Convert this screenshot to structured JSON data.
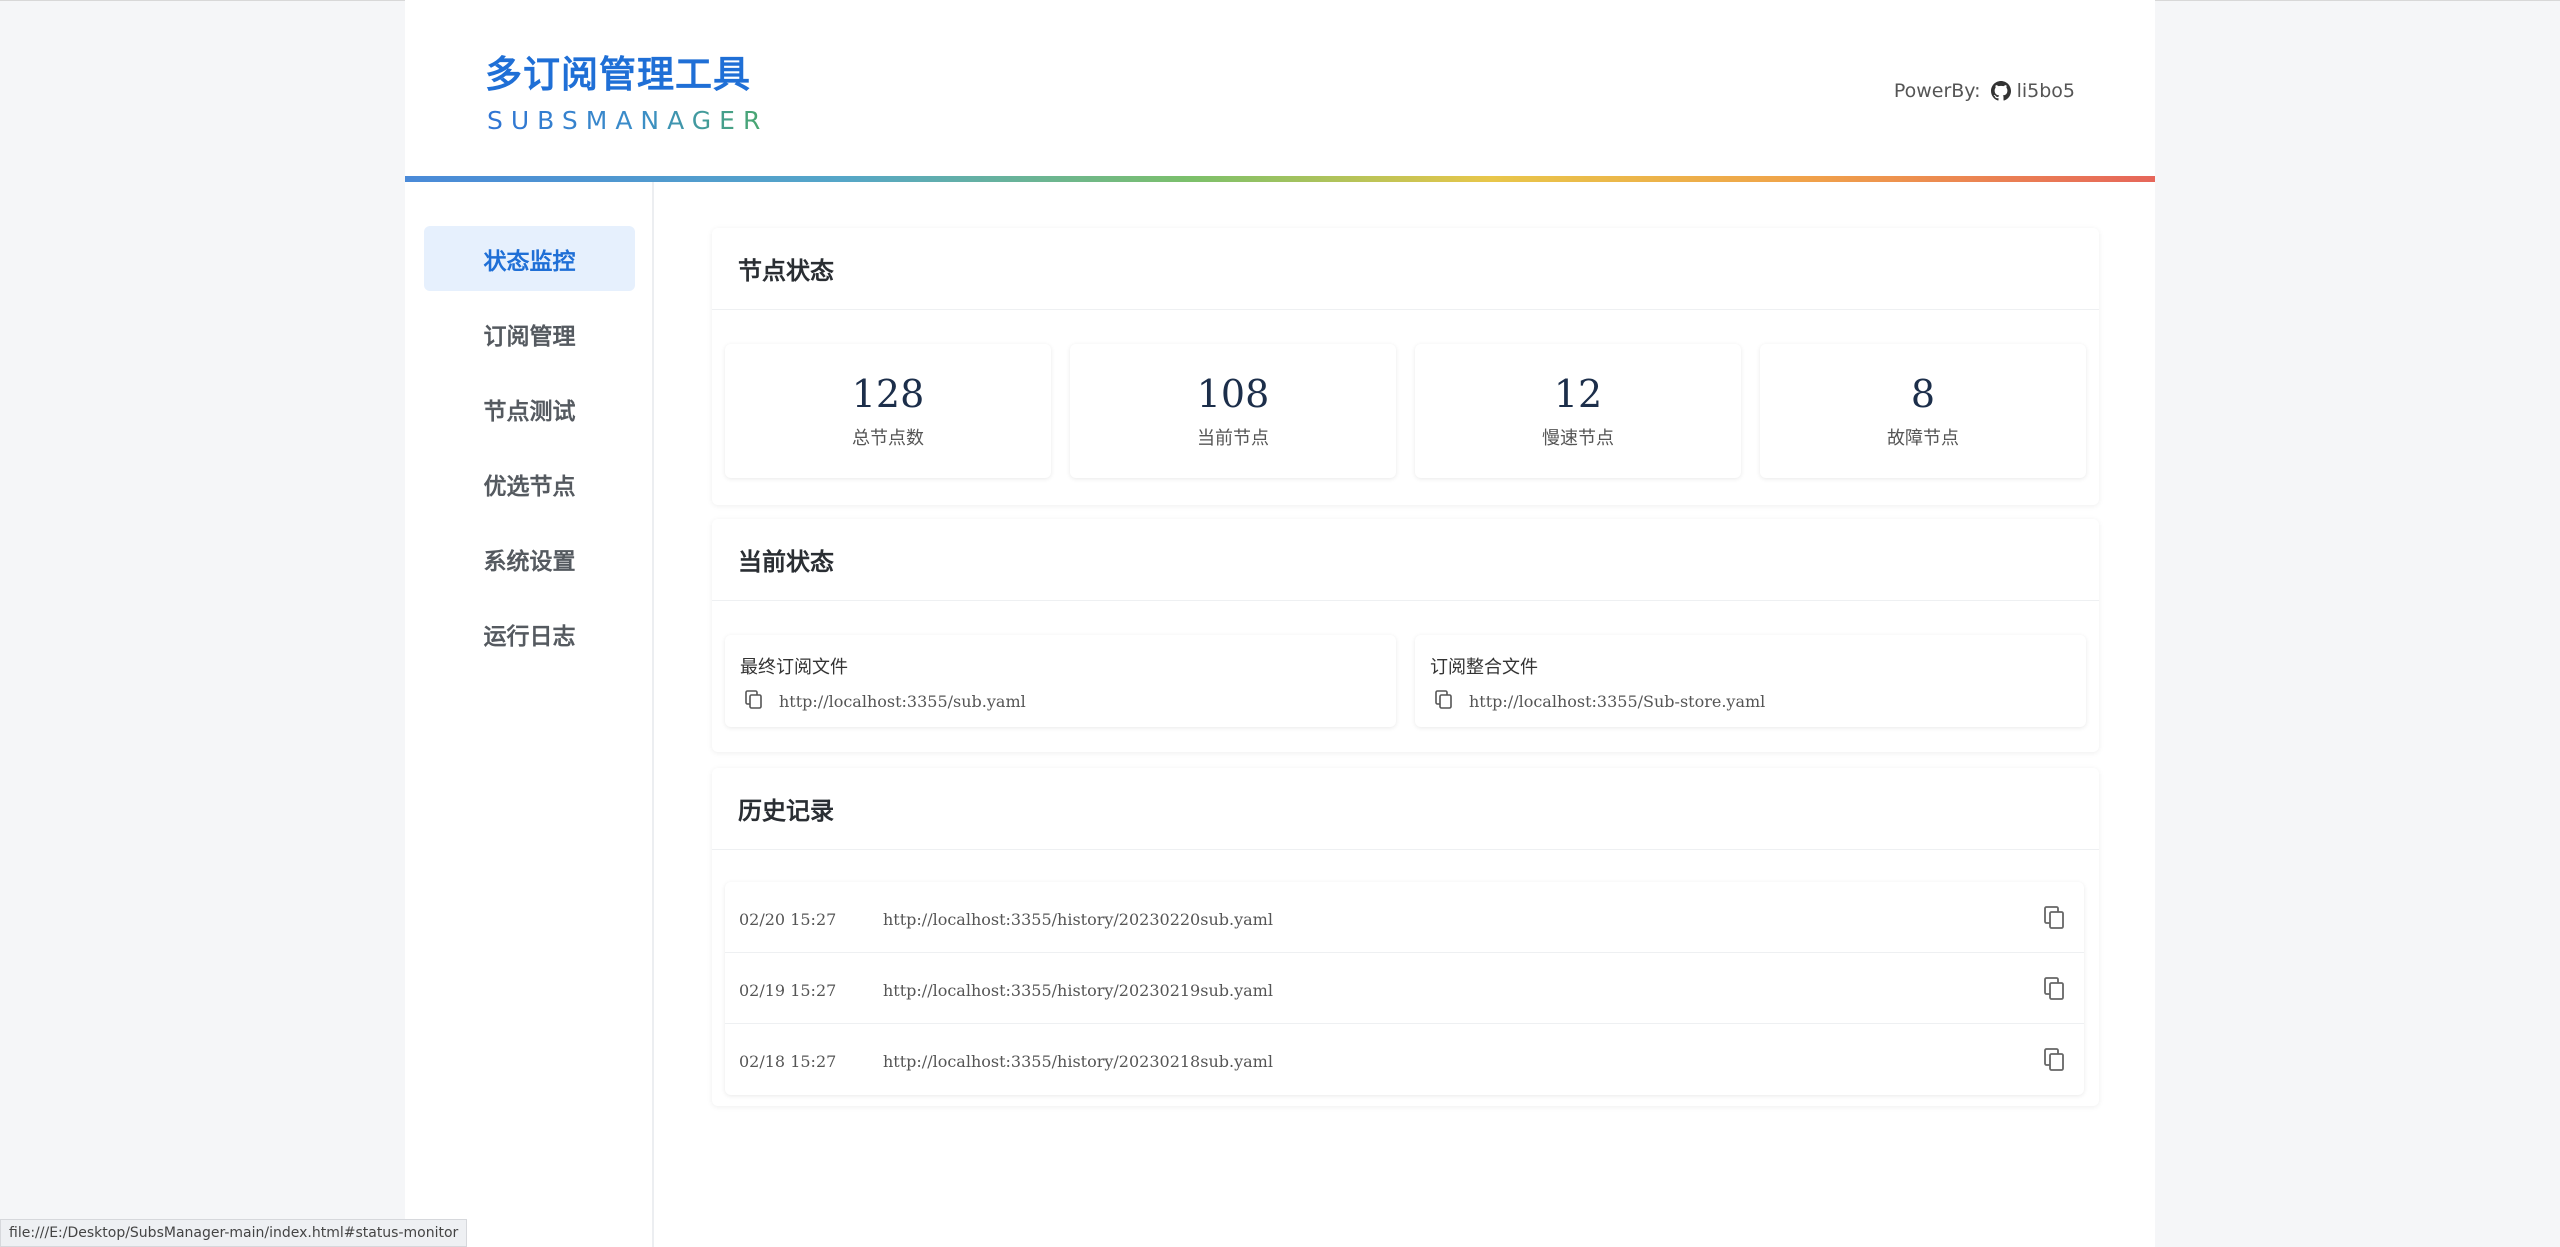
{
  "header": {
    "title": "多订阅管理工具",
    "subtitle": "SUBSMANAGER",
    "powerby_label": "PowerBy:",
    "powerby_user": "li5bo5",
    "github_icon": "github-icon"
  },
  "sidebar": {
    "items": [
      {
        "label": "状态监控",
        "active": true
      },
      {
        "label": "订阅管理",
        "active": false
      },
      {
        "label": "节点测试",
        "active": false
      },
      {
        "label": "优选节点",
        "active": false
      },
      {
        "label": "系统设置",
        "active": false
      },
      {
        "label": "运行日志",
        "active": false
      }
    ]
  },
  "node_status": {
    "title": "节点状态",
    "stats": [
      {
        "value": "128",
        "label": "总节点数"
      },
      {
        "value": "108",
        "label": "当前节点"
      },
      {
        "value": "12",
        "label": "慢速节点"
      },
      {
        "value": "8",
        "label": "故障节点"
      }
    ]
  },
  "current_status": {
    "title": "当前状态",
    "files": [
      {
        "title": "最终订阅文件",
        "url": "http://localhost:3355/sub.yaml"
      },
      {
        "title": "订阅整合文件",
        "url": "http://localhost:3355/Sub-store.yaml"
      }
    ]
  },
  "history": {
    "title": "历史记录",
    "rows": [
      {
        "time": "02/20 15:27",
        "url": "http://localhost:3355/history/20230220sub.yaml"
      },
      {
        "time": "02/19 15:27",
        "url": "http://localhost:3355/history/20230219sub.yaml"
      },
      {
        "time": "02/18 15:27",
        "url": "http://localhost:3355/history/20230218sub.yaml"
      }
    ]
  },
  "statusbar": {
    "text": "file:///E:/Desktop/SubsManager-main/index.html#status-monitor"
  },
  "colors": {
    "accent": "#1f6fd6",
    "active_bg": "#e6f0fd",
    "page_bg": "#f5f6f8"
  }
}
